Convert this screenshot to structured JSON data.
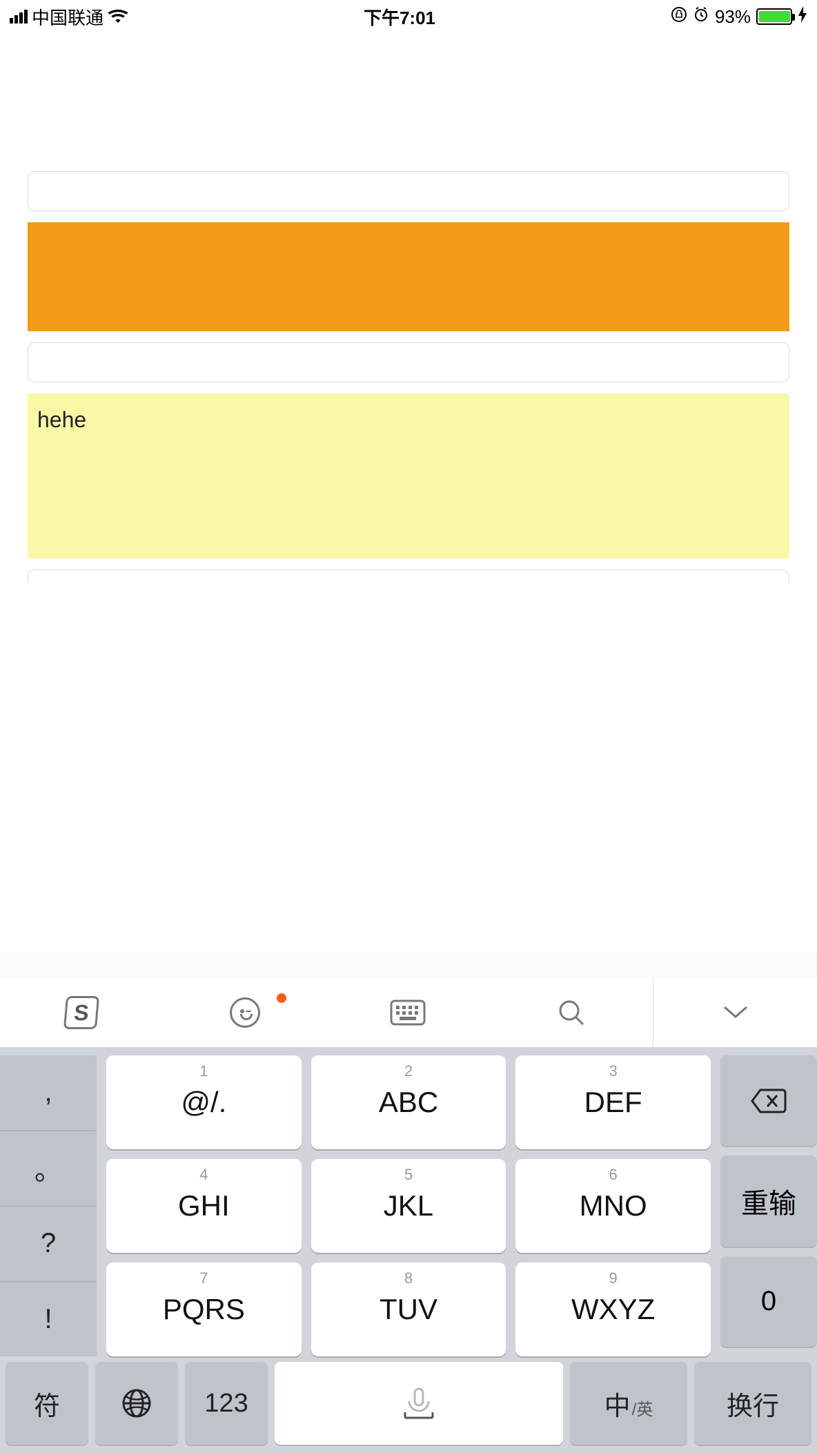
{
  "status": {
    "carrier": "中国联通",
    "time": "下午7:01",
    "battery_pct": "93%"
  },
  "content": {
    "yellow_text": "hehe"
  },
  "keyboard": {
    "toolbar": {
      "sogou": "S"
    },
    "left_side": [
      ",",
      "。",
      "?",
      "!"
    ],
    "keys": [
      {
        "hint": "1",
        "label": "@/."
      },
      {
        "hint": "2",
        "label": "ABC"
      },
      {
        "hint": "3",
        "label": "DEF"
      },
      {
        "hint": "4",
        "label": "GHI"
      },
      {
        "hint": "5",
        "label": "JKL"
      },
      {
        "hint": "6",
        "label": "MNO"
      },
      {
        "hint": "7",
        "label": "PQRS"
      },
      {
        "hint": "8",
        "label": "TUV"
      },
      {
        "hint": "9",
        "label": "WXYZ"
      }
    ],
    "right_side": {
      "retype": "重输",
      "zero": "0"
    },
    "bottom": {
      "sym": "符",
      "num": "123",
      "lang_main": "中",
      "lang_sub": "/英",
      "enter": "换行"
    }
  }
}
